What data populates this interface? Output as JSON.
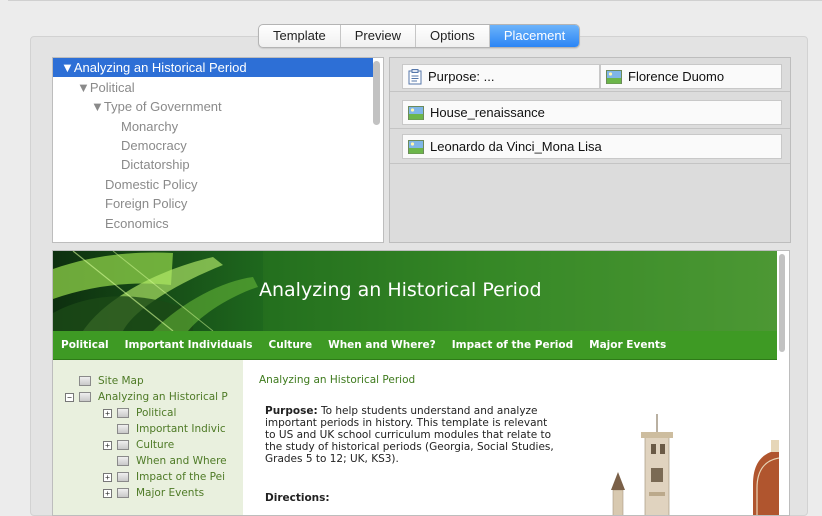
{
  "tabs": [
    "Template",
    "Preview",
    "Options",
    "Placement"
  ],
  "active_tab": "Placement",
  "tree": [
    {
      "label": "▼Analyzing an Historical Period",
      "level": 0,
      "selected": true
    },
    {
      "label": "▼Political",
      "level": 1
    },
    {
      "label": "▼Type of Government",
      "level": 2
    },
    {
      "label": "Monarchy",
      "level": 3
    },
    {
      "label": "Democracy",
      "level": 3
    },
    {
      "label": "Dictatorship",
      "level": 3
    },
    {
      "label": "Domestic Policy",
      "level": 2
    },
    {
      "label": "Foreign Policy",
      "level": 2
    },
    {
      "label": "Economics",
      "level": 2
    }
  ],
  "placements": [
    {
      "label": "Purpose: ...",
      "icon": "document-icon"
    },
    {
      "label": "Florence Duomo",
      "icon": "image-icon"
    },
    {
      "label": "House_renaissance",
      "icon": "image-icon"
    },
    {
      "label": "Leonardo da Vinci_Mona Lisa",
      "icon": "image-icon"
    }
  ],
  "preview": {
    "banner_title": "Analyzing an Historical Period",
    "nav": [
      "Political",
      "Important Individuals",
      "Culture",
      "When and Where?",
      "Impact of the Period",
      "Major Events"
    ],
    "sidebar": [
      {
        "label": "Site Map",
        "expander": false,
        "indent": 0
      },
      {
        "label": "Analyzing an Historical P",
        "expander": "minus",
        "indent": 0
      },
      {
        "label": "Political",
        "expander": "plus",
        "indent": 1
      },
      {
        "label": "Important Indivic",
        "expander": false,
        "indent": 1
      },
      {
        "label": "Culture",
        "expander": "plus",
        "indent": 1
      },
      {
        "label": "When and Where",
        "expander": false,
        "indent": 1
      },
      {
        "label": "Impact of the Pei",
        "expander": "plus",
        "indent": 1
      },
      {
        "label": "Major Events",
        "expander": "plus",
        "indent": 1
      }
    ],
    "breadcrumb": "Analyzing an Historical Period",
    "purpose_label": "Purpose:",
    "purpose_text": "To help students understand and analyze important periods in history. This template is relevant to US and UK school curriculum modules that relate to the study of historical periods (Georgia, Social Studies, Grades 5 to 12; UK, KS3).",
    "directions_label": "Directions:"
  },
  "colors": {
    "selection": "#2d6fd6",
    "tab_active": "#2a85f5",
    "banner_green": "#3e9a24",
    "sidebar_bg": "#e9f0de",
    "link_green": "#4e7a26"
  }
}
